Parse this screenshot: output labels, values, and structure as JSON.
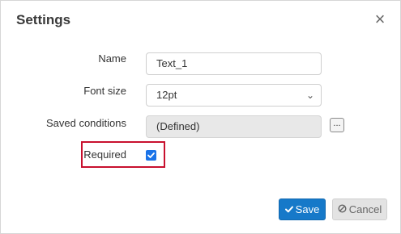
{
  "dialog": {
    "title": "Settings",
    "close_glyph": "×",
    "close_icon": "close-icon"
  },
  "form": {
    "name": {
      "label": "Name",
      "value": "Text_1"
    },
    "font_size": {
      "label": "Font size",
      "value": "12pt",
      "chevron": "⌄",
      "chevron_icon": "chevron-down-icon"
    },
    "saved_conditions": {
      "label": "Saved conditions",
      "value": "(Defined)",
      "button": "..."
    },
    "required": {
      "label": "Required",
      "checked": true
    }
  },
  "footer": {
    "save_label": "Save",
    "save_icon": "checkmark-icon",
    "cancel_label": "Cancel",
    "cancel_icon": "ban-icon"
  },
  "colors": {
    "primary": "#1679c9",
    "checkbox": "#1a73e8",
    "highlight": "#c8102e",
    "cancel_bg": "#e3e3e3"
  }
}
